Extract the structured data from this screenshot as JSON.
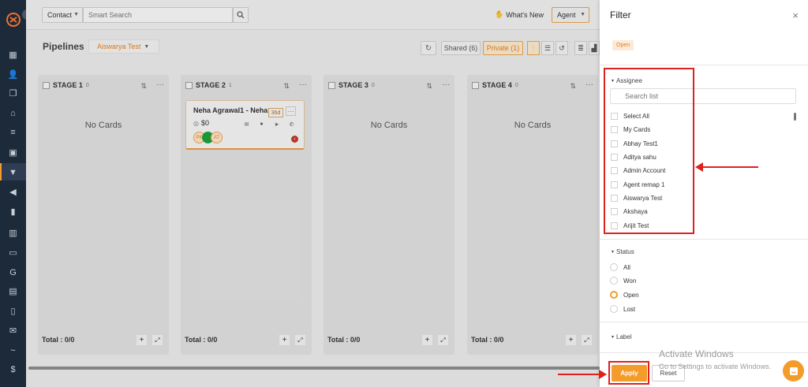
{
  "topbar": {
    "context_select": "Contact",
    "search_placeholder": "Smart Search",
    "whats_new": "What's New",
    "agent_button": "Agent"
  },
  "page": {
    "title": "Pipelines",
    "pipeline_select": "Aiswarya Test",
    "shared_label": "Shared (6)",
    "private_label": "Private (1)"
  },
  "stages": [
    {
      "name": "STAGE 1",
      "count": "0",
      "empty_text": "No Cards",
      "total": "Total : 0/0"
    },
    {
      "name": "STAGE 2",
      "count": "1",
      "empty_text": "",
      "total": "Total : 0/0"
    },
    {
      "name": "STAGE 3",
      "count": "0",
      "empty_text": "No Cards",
      "total": "Total : 0/0"
    },
    {
      "name": "STAGE 4",
      "count": "0",
      "empty_text": "No Cards",
      "total": "Total : 0/0"
    }
  ],
  "deal_card": {
    "name": "Neha Agrawal1 - Neha",
    "days": "36d",
    "amount": "$0",
    "avatar_1": "PK",
    "avatar_3": "AT"
  },
  "filter": {
    "title": "Filter",
    "active_chip": "Open",
    "assignee_label": "Assignee",
    "search_placeholder": "Search list",
    "assignees": [
      "Select All",
      "My Cards",
      "Abhay Test1",
      "Aditya sahu",
      "Admin Account",
      "Agent remap 1",
      "Aiswarya Test",
      "Akshaya",
      "Arijit Test"
    ],
    "status_label": "Status",
    "statuses": [
      "All",
      "Won",
      "Open",
      "Lost"
    ],
    "selected_status": "Open",
    "label_label": "Label",
    "apply": "Apply",
    "reset": "Reset"
  },
  "watermark": {
    "title": "Activate Windows",
    "subtitle": "Go to Settings to activate Windows."
  },
  "colors": {
    "accent": "#f39c2c",
    "sidebar": "#1d2a3a",
    "annotation_red": "#e0201c"
  }
}
